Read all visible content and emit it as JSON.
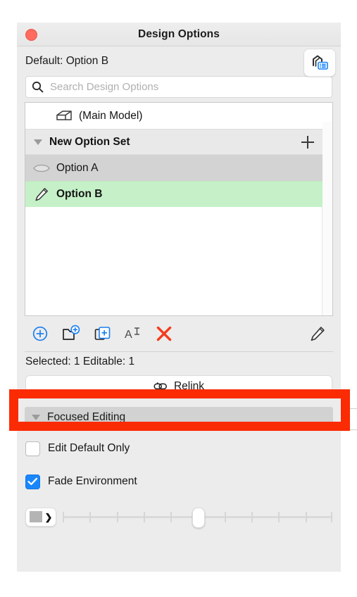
{
  "window": {
    "title": "Design Options",
    "close_icon": "close-dot-icon"
  },
  "default_row": {
    "label": "Default: Option B",
    "model_list_button_icon": "model-list-icon"
  },
  "search": {
    "placeholder": "Search Design Options",
    "value": "",
    "icon": "search-icon"
  },
  "option_list": {
    "rows": [
      {
        "label": "(Main Model)",
        "icon": "house-model-icon",
        "state": "normal",
        "indent": 1,
        "bold": false
      },
      {
        "label": "New Option Set",
        "icon": "disclosure-triangle-icon",
        "state": "group",
        "indent": 0,
        "bold": true,
        "add_icon": "plus-icon"
      },
      {
        "label": "Option A",
        "icon": "lens-shape-icon",
        "state": "selected-inactive",
        "indent": 0,
        "bold": false
      },
      {
        "label": "Option B",
        "icon": "pencil-icon",
        "state": "active-editing",
        "indent": 0,
        "bold": true
      }
    ]
  },
  "list_toolbar": {
    "buttons": [
      {
        "name": "new-option-set",
        "icon": "circle-plus-icon"
      },
      {
        "name": "new-option",
        "icon": "folder-plus-icon"
      },
      {
        "name": "duplicate-option",
        "icon": "copy-plus-icon"
      },
      {
        "name": "rename-option",
        "icon": "rename-text-icon"
      },
      {
        "name": "delete-option",
        "icon": "red-x-icon"
      },
      {
        "name": "edit-option",
        "icon": "pencil-icon"
      }
    ]
  },
  "status": {
    "text": "Selected: 1 Editable: 1"
  },
  "relink": {
    "label": "Relink",
    "icon": "chain-links-icon"
  },
  "focused_editing": {
    "section_title": "Focused Editing",
    "disclosure_icon": "disclosure-triangle-icon",
    "checkboxes": [
      {
        "label": "Edit Default Only",
        "checked": false
      },
      {
        "label": "Fade Environment",
        "checked": true
      }
    ],
    "slider": {
      "swatch_button_icon": "color-swatch-chevron-icon",
      "ticks": 11,
      "value_index": 5
    }
  },
  "colors": {
    "accent_blue": "#1a86fb",
    "highlight_red": "#fb2b04",
    "close_red": "#ff6b5e",
    "active_green": "#c6f0c7",
    "selected_gray": "#d3d3d3",
    "panel_bg": "#ececec"
  },
  "annotation": {
    "highlight_target": "relink-button",
    "highlight_color": "#fb2b04"
  }
}
